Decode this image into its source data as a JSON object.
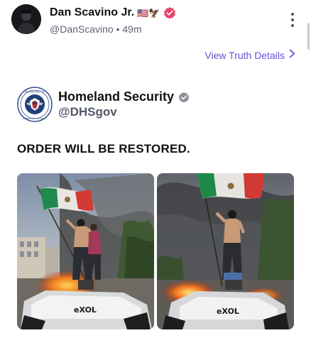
{
  "post": {
    "author_name": "Dan Scavino Jr.",
    "author_emoji": "🇺🇸🦅",
    "handle": "@DanScavino",
    "separator": "•",
    "time_ago": "49m"
  },
  "links": {
    "view_details": "View Truth Details"
  },
  "quoted_account": {
    "name": "Homeland Security",
    "handle": "@DHSgov",
    "seal_text_top": "DEPARTMENT OF",
    "seal_text_bottom": "HOMELAND SECURITY"
  },
  "headline": "ORDER WILL BE RESTORED.",
  "media": {
    "image_count": 2,
    "vehicle_text": "eXOL"
  },
  "icons": {
    "verified": "verified-badge-icon",
    "more": "more-vertical-icon",
    "chevron": "chevron-right-icon"
  },
  "colors": {
    "accent": "#5b55d6",
    "verified_pink": "#e5436a",
    "verified_gray": "#8a8f98"
  }
}
